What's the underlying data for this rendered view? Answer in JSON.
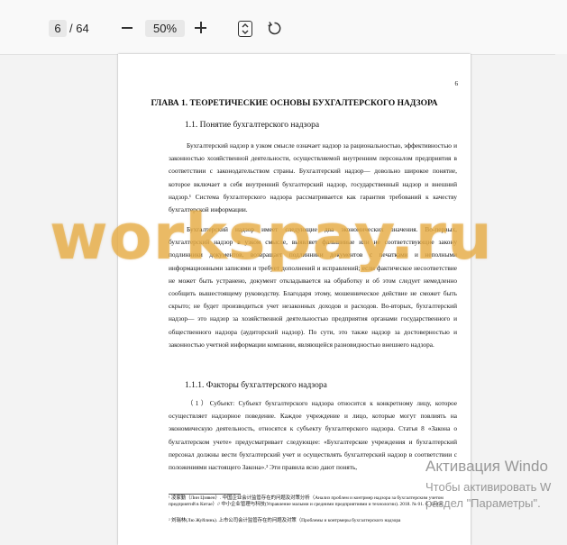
{
  "toolbar": {
    "current_page": "6",
    "total_pages": "/ 64",
    "zoom": "50%",
    "icons": [
      "zoom-out-icon",
      "zoom-in-icon",
      "fit-page-icon",
      "rotate-icon"
    ]
  },
  "document": {
    "page_number": "6",
    "chapter_title": "ГЛАВА 1. ТЕОРЕТИЧЕСКИЕ ОСНОВЫ БУХГАЛТЕРСКОГО НАДЗОРА",
    "section_title": "1.1.  Понятие бухгалтерского надзора",
    "paragraph_1": "Бухгалтерский надзор в узком смысле означает надзор за рациональностью, эффективностью и законностью хозяйственной деятельности, осуществляемой внутренним персоналом предприятия в соответствии с законодательством страны. Бухгалтерский надзор— довольно широкое понятие, которое включает в себя внутренний бухгалтерский надзор, государственный надзор и внешний надзор.¹ Система бухгалтерского надзора рассматривается как гарантия требований к качеству бухгалтерской информации.",
    "paragraph_2": "Бухгалтерский надзор имеет следующие два экономических значения. Во-первых, бухгалтерский надзор в узком смысле, выявляет фальшивые или не соответствующие закону подлинники документов, возвращает подлинники документов с печатками и неполными информационными записями и требует дополнений и исправлений; если фактическое несоответствие не может быть устранено, документ откладывается на обработку и об этом следует немедленно сообщить вышестоящему руководству. Благодаря этому, мошенническое действие не сможет быть скрыто; не будет производиться учет незаконных доходов и расходов. Во-вторых, бухгалтерский надзор— это надзор за хозяйственной деятельностью предприятия органами государственного и общественного надзора (аудиторский надзор). По сути, это также надзор за достоверностью и законностью учетной информации компании, являющейся разновидностью внешнего надзора.",
    "subsection_title": "1.1.1. Факторы бухгалтерского надзора",
    "paragraph_3": "（1）Субъект: Субъект бухгалтерского надзора относится к конкретному лицу, которое осуществляет надзорное поведение. Каждое учреждение и лицо, которые могут повлиять на экономическую деятельность, относятся к субъекту бухгалтерского надзора. Статья 8 «Закона о бухгалтерском учете» предусматривает следующее: «Бухгалтерские учреждения и бухгалтерский персонал должны вести бухгалтерский учет и осуществлять бухгалтерский надзор в соответствии с положениями настоящего Закона».² Эти правила ясно дают понять,",
    "footnote_1": "¹ 凌家勤（Лин Цзявен）. 中国企业会计监管存在的问题及对策分析（Анализ проблем и контрмер надзора за бухгалтерским учетом предприятий в Китае）// 中小企业管理与科技(Управление малыми и средними предприятиями и технологии). 2018. № 01. С. 66-68.",
    "footnote_2": "² 刘瑞林(Лю Жуйлинь). 上市公司会计监管存在的问题及对策（Проблемы и контрмеры бухгалтерского надзора"
  },
  "overlays": {
    "watermark": "workspay.ru",
    "activation_title": "Активация Windo",
    "activation_line1": "Чтобы активировать W",
    "activation_line2": "раздел \"Параметры\"."
  }
}
